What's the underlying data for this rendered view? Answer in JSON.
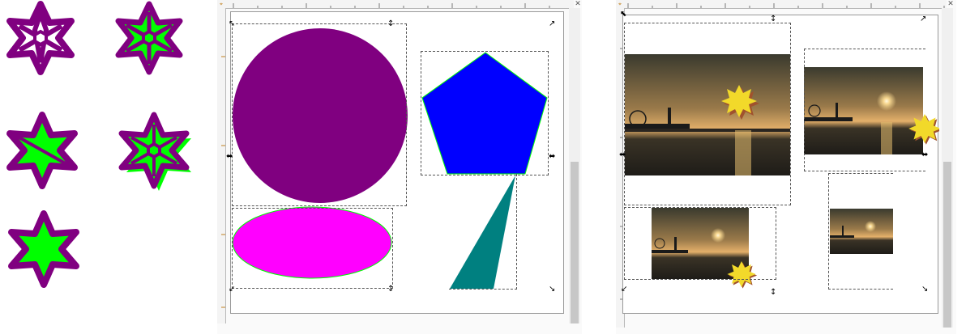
{
  "colors": {
    "purple": "#800080",
    "green": "#00ff00",
    "blue": "#0000ff",
    "magenta": "#ff00ff",
    "teal": "#008080",
    "sun_yellow": "#f2d92a",
    "sun_shadow": "#c0392b"
  },
  "left_panel": {
    "stars": [
      {
        "name": "purple-outline-star",
        "style": "outline"
      },
      {
        "name": "green-fill-star",
        "style": "green-fill"
      },
      {
        "name": "green-diagonal-star",
        "style": "diagonal"
      },
      {
        "name": "green-shadow-star",
        "style": "shadow"
      },
      {
        "name": "green-solid-star",
        "style": "solid"
      }
    ]
  },
  "middle_editor": {
    "ruler_icon": "ruler-corner-icon",
    "close_icon": "close-icon",
    "shapes": [
      "purple-circle",
      "blue-pentagon",
      "magenta-ellipse",
      "teal-triangle"
    ]
  },
  "right_editor": {
    "ruler_icon": "ruler-corner-icon",
    "close_icon": "close-icon",
    "photos": [
      "sunset-photo-large",
      "sunset-photo-medium",
      "sunset-photo-small",
      "sunset-photo-tiny"
    ],
    "sticker_icon": "sunburst-icon"
  }
}
